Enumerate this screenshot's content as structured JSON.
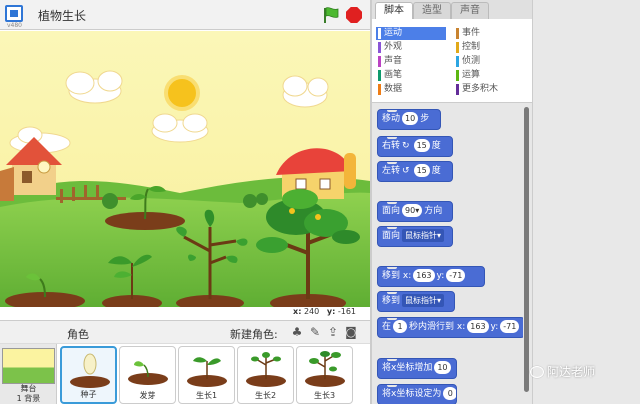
{
  "header": {
    "version": "v480",
    "title": "植物生长"
  },
  "stage": {
    "mouse_x_label": "x:",
    "mouse_x": "240",
    "mouse_y_label": "y:",
    "mouse_y": "-161"
  },
  "sprites_pane": {
    "label": "角色",
    "new_sprite_label": "新建角色:",
    "stage_thumb_label": "舞台\n1 背景",
    "sprites": [
      {
        "name": "种子"
      },
      {
        "name": "发芽"
      },
      {
        "name": "生长1"
      },
      {
        "name": "生长2"
      },
      {
        "name": "生长3"
      }
    ]
  },
  "tabs": [
    {
      "label": "脚本",
      "active": true
    },
    {
      "label": "造型",
      "active": false
    },
    {
      "label": "声音",
      "active": false
    }
  ],
  "categories": [
    {
      "label": "运动",
      "color": "#4a6cd4",
      "active": true
    },
    {
      "label": "外观",
      "color": "#8a55d7",
      "active": false
    },
    {
      "label": "声音",
      "color": "#bb42c3",
      "active": false
    },
    {
      "label": "画笔",
      "color": "#0e9a6c",
      "active": false
    },
    {
      "label": "数据",
      "color": "#ee7d16",
      "active": false
    },
    {
      "label": "事件",
      "color": "#c88330",
      "active": false
    },
    {
      "label": "控制",
      "color": "#e1a91a",
      "active": false
    },
    {
      "label": "侦测",
      "color": "#2ca5e2",
      "active": false
    },
    {
      "label": "运算",
      "color": "#5cb712",
      "active": false
    },
    {
      "label": "更多积木",
      "color": "#632d99",
      "active": false
    }
  ],
  "blocks": {
    "move": {
      "pre": "移动",
      "value": "10",
      "post": "步"
    },
    "turn_right": {
      "pre": "右转",
      "icon": "↻",
      "value": "15",
      "post": "度"
    },
    "turn_left": {
      "pre": "左转",
      "icon": "↺",
      "value": "15",
      "post": "度"
    },
    "point_direction": {
      "pre": "面向",
      "value": "90▾",
      "post": "方向"
    },
    "point_towards": {
      "pre": "面向",
      "dropdown": "鼠标指针▾"
    },
    "goto_xy": {
      "pre": "移到",
      "x_label": "x:",
      "x": "163",
      "y_label": "y:",
      "y": "-71"
    },
    "goto": {
      "pre": "移到",
      "dropdown": "鼠标指针▾"
    },
    "glide": {
      "pre": "在",
      "secs": "1",
      "mid": "秒内滑行到",
      "x_label": "x:",
      "x": "163",
      "y_label": "y:",
      "y": "-71"
    },
    "change_x": {
      "pre": "将x坐标增加",
      "value": "10"
    },
    "set_x": {
      "pre": "将x坐标设定为",
      "value": "0"
    }
  },
  "watermark": "阿达老师"
}
